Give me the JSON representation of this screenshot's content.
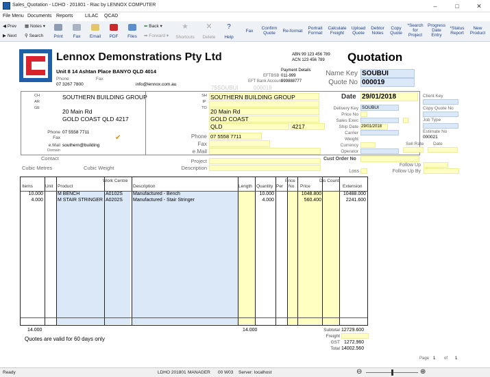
{
  "window": {
    "title": "Sales_Quotation - LDHO - 201801 - Riac by LENNOX COMPUTER",
    "minimize": "–",
    "maximize": "□",
    "close": "✕"
  },
  "menu": [
    "File Menu",
    "Documents",
    "Reports",
    "LILAC",
    "QCAD"
  ],
  "toolbar": {
    "prev": "Prev",
    "next": "Next",
    "notes": "Notes",
    "search": "Search",
    "print": "Print",
    "fax": "Fax",
    "email": "Email",
    "pdf": "PDF",
    "files": "Files",
    "back": "Back",
    "forward": "Forward",
    "shortcuts": "Shortcuts",
    "delete": "Delete",
    "help": "Help",
    "right_buttons": [
      [
        "Fax",
        ""
      ],
      [
        "Confirm",
        "Quote"
      ],
      [
        "Re-format",
        ""
      ],
      [
        "Portrait",
        "Format"
      ],
      [
        "Calculate",
        "Freight"
      ],
      [
        "Upload",
        "Quote"
      ],
      [
        "Debtor",
        "Notes"
      ],
      [
        "Copy",
        "Quote"
      ],
      [
        "*Search",
        "for",
        "Project"
      ],
      [
        "Progress",
        "Date",
        "Entry"
      ],
      [
        "*Status",
        "Report"
      ],
      [
        "New",
        "Product"
      ]
    ]
  },
  "company": {
    "name": "Lennox Demonstrations Pty Ltd",
    "address": "Unit 8 14 Ashtan Place BANYO QLD 4014",
    "phone_label": "Phone",
    "phone": "07 3267 7800",
    "fax_label": "Fax",
    "email": "info@lennox.com.au",
    "abn": "ABN 99 123 456 789",
    "acn": "ACN 123 456 789",
    "payment_details": "Payment Details",
    "eftbsb_label": "EFTBSB",
    "eftbsb": "011-999",
    "eft_account_label": "EFT Bank Account",
    "eft_account": "999888777",
    "watermark_code": "75SOUBUI",
    "watermark_num": "000019"
  },
  "doc": {
    "title": "Quotation",
    "name_key_label": "Name Key",
    "name_key": "SOUBUI",
    "quote_no_label": "Quote No",
    "quote_no": "000019",
    "date_label": "Date",
    "date": "29/01/2018"
  },
  "charge": {
    "side_label": "CHARGE",
    "name": "SOUTHERN BUILDING GROUP",
    "addr1": "20 Main Rd",
    "addr2": "GOLD COAST QLD 4217",
    "phone_label": "Phone",
    "phone": "07 5558 7711",
    "fax_label": "Fax",
    "email_label": "e.Mail",
    "email": "southern@building",
    "domain_label": "Domain",
    "check": "✔"
  },
  "ship": {
    "side_label": "SHIPTO",
    "name": "SOUTHERN BUILDING GROUP",
    "addr1": "20 Main Rd",
    "addr2": "GOLD COAST",
    "state": "QLD",
    "postcode": "4217",
    "phone_label": "Phone",
    "phone": "07 5558 7711",
    "fax_label": "Fax",
    "email_label": "e.Mail"
  },
  "details": {
    "delivery_key_label": "Delivery Key",
    "delivery_key": "SOUBUI",
    "price_no_label": "Price No",
    "sales_exec_label": "Sales Exec",
    "ship_date_label": "Ship Date",
    "ship_date": "29/01/2018",
    "carrier_label": "Carrier",
    "weight_label": "Weight",
    "currency_label": "Currency",
    "operator_label": "Operator",
    "client_key_label": "Client Key",
    "copy_quote_label": "Copy Quote No",
    "job_type_label": "Job Type",
    "estimate_no_label": "Estimate No",
    "estimate_no": "000021",
    "sell_rate_label": "Sell Rate",
    "date_label": "Date",
    "cust_order_label": "Cust Order No",
    "follow_up_label": "Follow Up",
    "follow_up_by_label": "Follow Up By",
    "loss_label": "Loss"
  },
  "misc": {
    "contact_label": "Contact",
    "project_label": "Project",
    "description_label": "Description",
    "cubic_metres_label": "Cubic Metres",
    "cubic_weight_label": "Cubic Weight"
  },
  "grid": {
    "headers": {
      "items": "Items",
      "unit": "Unit",
      "product": "Product",
      "work_centre": "Work Centre",
      "description": "Description",
      "length": "Length",
      "quantity": "Quantity",
      "per": "Per",
      "price_top": "Price",
      "no": "No",
      "price": "Price",
      "dis_count": "Dis Count",
      "extension": "Extension"
    },
    "rows": [
      {
        "items": "10.000",
        "product": "M BENCH",
        "wc": "A0102S",
        "description": "Manufactured - Bench",
        "quantity": "10.000",
        "price": "1048.800",
        "extension": "10488.000"
      },
      {
        "items": "4.000",
        "product": "M STAIR STRINGER",
        "wc": "A0202S",
        "description": "Manufactured - Stair Stringer",
        "quantity": "4.000",
        "price": "560.400",
        "extension": "2241.600"
      }
    ],
    "total_items": "14.000",
    "total_quantity": "14.000"
  },
  "footer": {
    "valid_note": "Quotes are valid for 60 days only",
    "subtotal_label": "Subtotal",
    "subtotal": "12729.600",
    "freight_label": "Freight",
    "gst_label": "GST",
    "gst": "1272.960",
    "total_label": "Total",
    "total": "14002.560",
    "page_label": "Page",
    "page": "1",
    "of_label": "of",
    "pages": "1"
  },
  "status": {
    "ready": "Ready",
    "company_code": "LDHO 201801",
    "user": "MANAGER",
    "session": "00 W03",
    "server": "Server: localhost",
    "zoom_out": "⊖",
    "zoom_in": "⊕",
    "zoom_level": 0.5
  },
  "colors": {
    "accent": "#1f5fa8",
    "field_yellow": "#ffffc2",
    "field_blue": "#dbe8f8",
    "logo_red": "#d9232d"
  }
}
